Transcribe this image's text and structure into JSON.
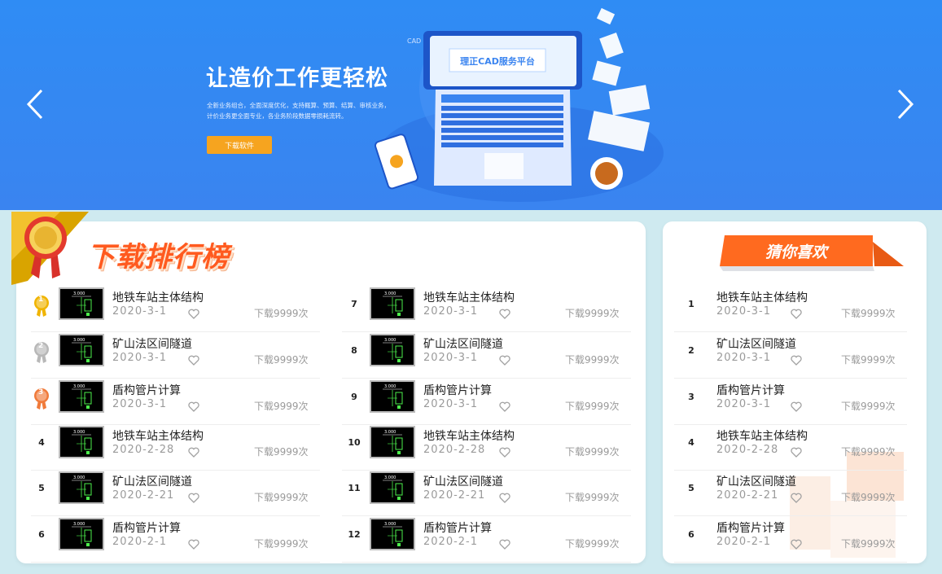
{
  "banner": {
    "title": "让造价工作更轻松",
    "subtitle": "全新业务组合，全面深度优化，支持概算、预算、结算、审核业务，计价业务更全面专业，各业务阶段数据零损耗流转。",
    "download_button": "下载软件",
    "screen_label": "理正CAD服务平台",
    "cad_label": "CAD"
  },
  "ranking": {
    "title": "下载排行榜",
    "items": [
      {
        "rank": "1",
        "title": "地铁车站主体结构",
        "date": "2020-3-1",
        "downloads": "下载9999次"
      },
      {
        "rank": "2",
        "title": "矿山法区间隧道",
        "date": "2020-3-1",
        "downloads": "下载9999次"
      },
      {
        "rank": "3",
        "title": "盾构管片计算",
        "date": "2020-3-1",
        "downloads": "下载9999次"
      },
      {
        "rank": "4",
        "title": "地铁车站主体结构",
        "date": "2020-2-28",
        "downloads": "下载9999次"
      },
      {
        "rank": "5",
        "title": "矿山法区间隧道",
        "date": "2020-2-21",
        "downloads": "下载9999次"
      },
      {
        "rank": "6",
        "title": "盾构管片计算",
        "date": "2020-2-1",
        "downloads": "下载9999次"
      },
      {
        "rank": "7",
        "title": "地铁车站主体结构",
        "date": "2020-3-1",
        "downloads": "下载9999次"
      },
      {
        "rank": "8",
        "title": "矿山法区间隧道",
        "date": "2020-3-1",
        "downloads": "下载9999次"
      },
      {
        "rank": "9",
        "title": "盾构管片计算",
        "date": "2020-3-1",
        "downloads": "下载9999次"
      },
      {
        "rank": "10",
        "title": "地铁车站主体结构",
        "date": "2020-2-28",
        "downloads": "下载9999次"
      },
      {
        "rank": "11",
        "title": "矿山法区间隧道",
        "date": "2020-2-21",
        "downloads": "下载9999次"
      },
      {
        "rank": "12",
        "title": "盾构管片计算",
        "date": "2020-2-1",
        "downloads": "下载9999次"
      }
    ]
  },
  "guess": {
    "title": "猜你喜欢",
    "items": [
      {
        "rank": "1",
        "title": "地铁车站主体结构",
        "date": "2020-3-1",
        "downloads": "下载9999次"
      },
      {
        "rank": "2",
        "title": "矿山法区间隧道",
        "date": "2020-3-1",
        "downloads": "下载9999次"
      },
      {
        "rank": "3",
        "title": "盾构管片计算",
        "date": "2020-3-1",
        "downloads": "下载9999次"
      },
      {
        "rank": "4",
        "title": "地铁车站主体结构",
        "date": "2020-2-28",
        "downloads": "下载9999次"
      },
      {
        "rank": "5",
        "title": "矿山法区间隧道",
        "date": "2020-2-21",
        "downloads": "下载9999次"
      },
      {
        "rank": "6",
        "title": "盾构管片计算",
        "date": "2020-2-1",
        "downloads": "下载9999次"
      }
    ]
  },
  "thumbnail_label": "3.000",
  "colors": {
    "banner_blue": "#3a84f0",
    "accent_orange": "#ff5a1f",
    "button_orange": "#f6a41f",
    "medal_gold": "#f0b400",
    "medal_silver": "#b8b8b8",
    "medal_bronze": "#f07a3a"
  },
  "icons": {
    "prev": "chevron-left-icon",
    "next": "chevron-right-icon",
    "favorite": "heart-icon",
    "medal": "medal-icon"
  }
}
